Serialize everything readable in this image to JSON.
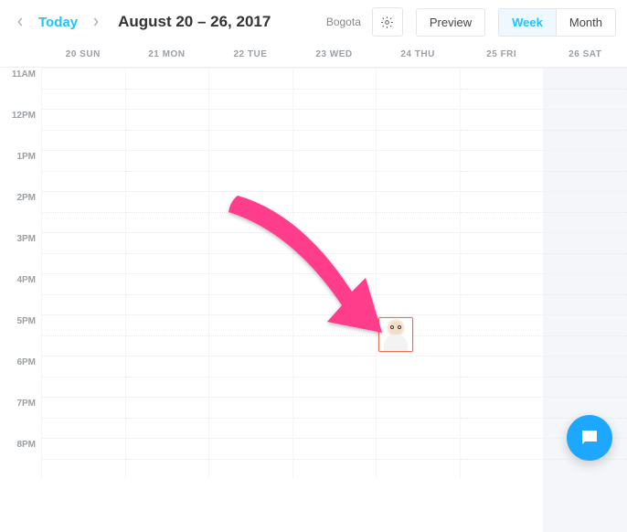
{
  "header": {
    "today_label": "Today",
    "title": "August 20 – 26, 2017",
    "timezone": "Bogota",
    "preview_label": "Preview",
    "view_week": "Week",
    "view_month": "Month",
    "active_view": "Week"
  },
  "days": [
    {
      "label": "20 SUN"
    },
    {
      "label": "21 MON"
    },
    {
      "label": "22 TUE"
    },
    {
      "label": "23 WED"
    },
    {
      "label": "24 THU"
    },
    {
      "label": "25 FRI"
    },
    {
      "label": "26 SAT",
      "today": true
    }
  ],
  "hours": [
    "11AM",
    "12PM",
    "1PM",
    "2PM",
    "3PM",
    "4PM",
    "5PM",
    "6PM",
    "7PM",
    "8PM"
  ],
  "event": {
    "day_index": 4,
    "hour_label": "5PM",
    "name": "appointment-avatar"
  }
}
